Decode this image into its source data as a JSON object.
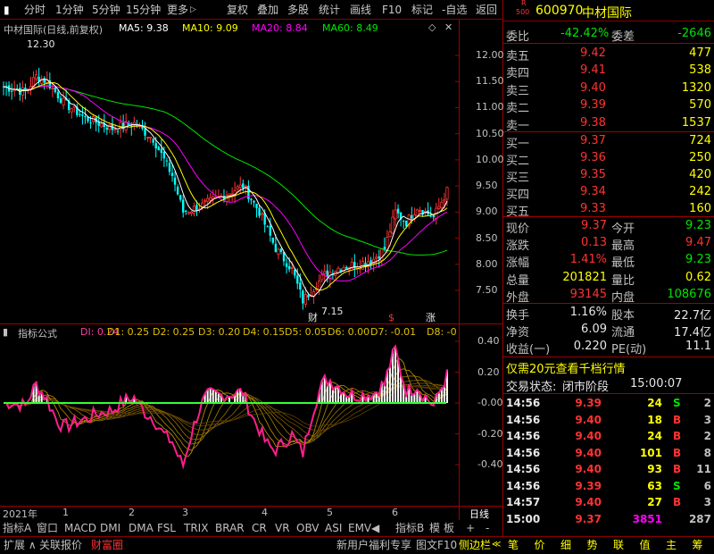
{
  "toolbar": {
    "items": [
      "分时",
      "1分钟",
      "5分钟",
      "15分钟",
      "更多"
    ],
    "more_arrow": "▷",
    "right_items": [
      "复权",
      "叠加",
      "多股",
      "统计",
      "画线",
      "F10",
      "标记",
      "-自选",
      "返回"
    ]
  },
  "main_chart": {
    "title": "中材国际(日线,前复权)",
    "ma5": "MA5: 9.38",
    "ma10": "MA10: 9.09",
    "ma20": "MA20: 8.84",
    "ma60": "MA60: 8.49",
    "high_label": "12.30",
    "low_label": "7.15",
    "y_ticks": [
      "12.00",
      "11.50",
      "11.00",
      "10.50",
      "10.00",
      "9.50",
      "9.00",
      "8.50",
      "8.00",
      "7.50"
    ],
    "marker_cai": "财",
    "marker_s": "$",
    "marker_zhang": "涨"
  },
  "indicator": {
    "name": "指标公式",
    "values": [
      {
        "label": "DI: 0.24",
        "color": "#ff3ca0"
      },
      {
        "label": "D1: 0.25",
        "color": "#e0c000"
      },
      {
        "label": "D2: 0.25",
        "color": "#e0c000"
      },
      {
        "label": "D3: 0.20",
        "color": "#e0c000"
      },
      {
        "label": "D4: 0.15",
        "color": "#e0c000"
      },
      {
        "label": "D5: 0.05",
        "color": "#e0c000"
      },
      {
        "label": "D6: 0.00",
        "color": "#e0c000"
      },
      {
        "label": "D7: -0.01",
        "color": "#e0c000"
      },
      {
        "label": "D8: -0",
        "color": "#e0c000"
      }
    ],
    "y_ticks": [
      "0.40",
      "0.20",
      "-0.00",
      "-0.20",
      "-0.40"
    ]
  },
  "x_axis": {
    "year": "2021年",
    "months": [
      "1",
      "2",
      "3",
      "4",
      "5",
      "6"
    ],
    "period": "日线"
  },
  "tabs": [
    "指标A",
    "窗口",
    "MACD",
    "DMI",
    "DMA",
    "FSL",
    "TRIX",
    "BRAR",
    "CR",
    "VR",
    "OBV",
    "ASI",
    "EMV",
    "指标B",
    "模",
    "板",
    "+",
    "-"
  ],
  "bottom": {
    "left": [
      "扩展 ∧",
      "关联报价",
      "财富圈"
    ],
    "promo": "新用户福利专享",
    "chart_f10": "图文F10",
    "side_bar": "侧边栏",
    "side_arrow": "≪",
    "right_tabs": [
      "笔",
      "价",
      "细",
      "势",
      "联",
      "值",
      "主",
      "筹"
    ]
  },
  "quote": {
    "code": "600970",
    "name": "中材国际",
    "badge_top": "R",
    "badge_bottom": "500",
    "weibi_label": "委比",
    "weibi": "-42.42%",
    "weicha_label": "委差",
    "weicha": "-2646",
    "asks": [
      {
        "label": "卖五",
        "price": "9.42",
        "vol": "477"
      },
      {
        "label": "卖四",
        "price": "9.41",
        "vol": "538"
      },
      {
        "label": "卖三",
        "price": "9.40",
        "vol": "1320"
      },
      {
        "label": "卖二",
        "price": "9.39",
        "vol": "570"
      },
      {
        "label": "卖一",
        "price": "9.38",
        "vol": "1537"
      }
    ],
    "bids": [
      {
        "label": "买一",
        "price": "9.37",
        "vol": "724"
      },
      {
        "label": "买二",
        "price": "9.36",
        "vol": "250"
      },
      {
        "label": "买三",
        "price": "9.35",
        "vol": "420"
      },
      {
        "label": "买四",
        "price": "9.34",
        "vol": "242"
      },
      {
        "label": "买五",
        "price": "9.33",
        "vol": "160"
      }
    ],
    "stats": [
      {
        "l1": "现价",
        "v1": "9.37",
        "c1": "red",
        "l2": "今开",
        "v2": "9.23",
        "c2": "green"
      },
      {
        "l1": "涨跌",
        "v1": "0.13",
        "c1": "red",
        "l2": "最高",
        "v2": "9.47",
        "c2": "red"
      },
      {
        "l1": "涨幅",
        "v1": "1.41%",
        "c1": "red",
        "l2": "最低",
        "v2": "9.23",
        "c2": "green"
      },
      {
        "l1": "总量",
        "v1": "201821",
        "c1": "yellow",
        "l2": "量比",
        "v2": "0.62",
        "c2": "yellow"
      },
      {
        "l1": "外盘",
        "v1": "93145",
        "c1": "red",
        "l2": "内盘",
        "v2": "108676",
        "c2": "green"
      }
    ],
    "stats2": [
      {
        "l1": "换手",
        "v1": "1.16%",
        "l2": "股本",
        "v2": "22.7亿"
      },
      {
        "l1": "净资",
        "v1": "6.09",
        "l2": "流通",
        "v2": "17.4亿"
      },
      {
        "l1": "收益(一)",
        "v1": "0.220",
        "l2": "PE(动)",
        "v2": "11.1"
      }
    ],
    "promo": "仅需20元查看千档行情",
    "trade_state_label": "交易状态:",
    "trade_state": "闭市阶段",
    "trade_time": "15:00:07",
    "ticks": [
      {
        "t": "14:56",
        "p": "9.39",
        "v": "24",
        "bs": "S",
        "n": "2"
      },
      {
        "t": "14:56",
        "p": "9.40",
        "v": "18",
        "bs": "B",
        "n": "3"
      },
      {
        "t": "14:56",
        "p": "9.40",
        "v": "24",
        "bs": "B",
        "n": "2"
      },
      {
        "t": "14:56",
        "p": "9.40",
        "v": "101",
        "bs": "B",
        "n": "8"
      },
      {
        "t": "14:56",
        "p": "9.40",
        "v": "93",
        "bs": "B",
        "n": "11"
      },
      {
        "t": "14:56",
        "p": "9.39",
        "v": "63",
        "bs": "S",
        "n": "6"
      },
      {
        "t": "14:57",
        "p": "9.40",
        "v": "27",
        "bs": "B",
        "n": "3"
      },
      {
        "t": "15:00",
        "p": "9.37",
        "v": "3851",
        "bs": "",
        "n": "287"
      }
    ]
  },
  "colors": {
    "up": "#ff3232",
    "down": "#00ffff",
    "ma5": "#ffffff",
    "ma10": "#ffff00",
    "ma20": "#ff00ff",
    "ma60": "#00e600",
    "frame": "#a00000"
  }
}
